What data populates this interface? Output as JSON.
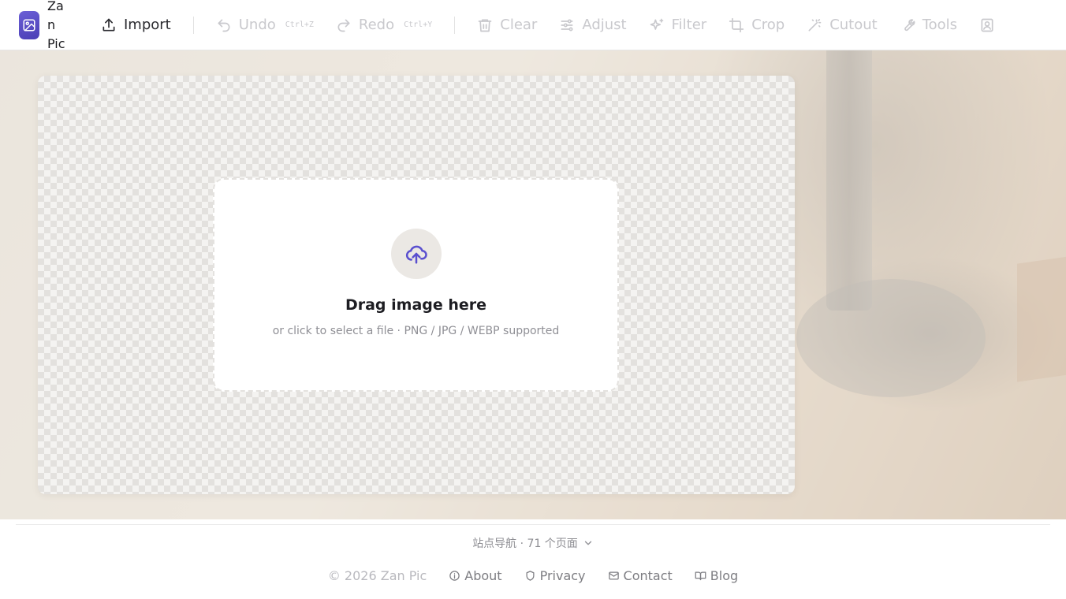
{
  "app": {
    "name": "Zan Pic"
  },
  "toolbar": {
    "import_label": "Import",
    "undo_label": "Undo",
    "undo_shortcut": "Ctrl+Z",
    "redo_label": "Redo",
    "redo_shortcut": "Ctrl+Y",
    "clear_label": "Clear",
    "adjust_label": "Adjust",
    "filter_label": "Filter",
    "crop_label": "Crop",
    "cutout_label": "Cutout",
    "tools_label": "Tools"
  },
  "dropzone": {
    "title": "Drag image here",
    "subtitle": "or click to select a file · PNG / JPG / WEBP supported"
  },
  "footer": {
    "site_nav": "站点导航 · 71 个页面",
    "copyright": "© 2026 Zan Pic",
    "links": [
      {
        "label": "About",
        "icon": "info-icon"
      },
      {
        "label": "Privacy",
        "icon": "shield-icon"
      },
      {
        "label": "Contact",
        "icon": "mail-icon"
      },
      {
        "label": "Blog",
        "icon": "book-icon"
      }
    ]
  },
  "colors": {
    "accent": "#5a4fcf",
    "disabled_text": "#c9c9cd",
    "muted_text": "#8e8e93"
  }
}
